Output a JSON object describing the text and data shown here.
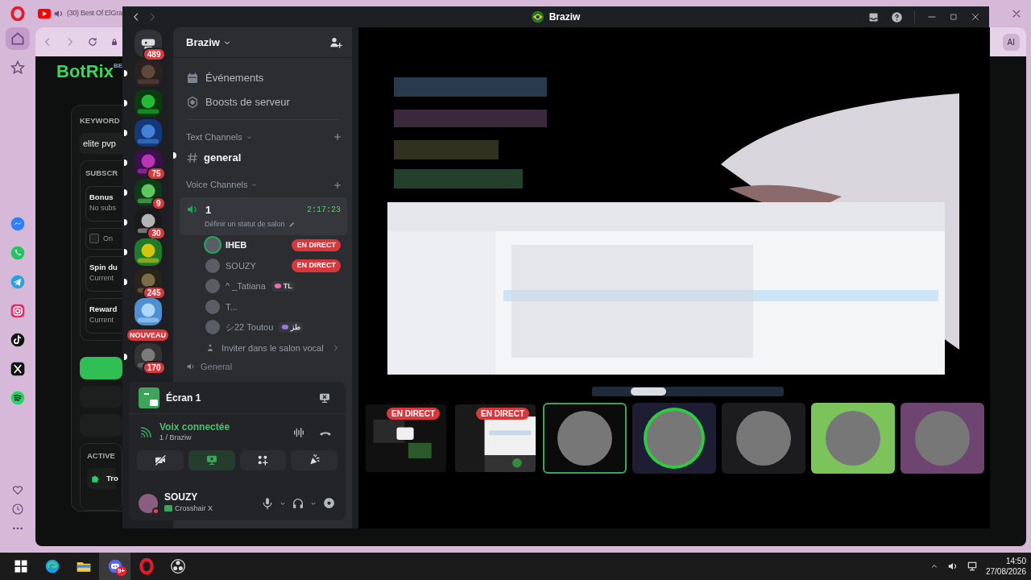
{
  "browser": {
    "tab_title": "(30) Best Of ElGra",
    "ai_button": "AI",
    "page": {
      "logo": "BotRix",
      "logo_badge": "BE",
      "keyword_label": "KEYWORD",
      "keyword_value": "elite pvp",
      "section_label": "SUBSCR",
      "rows": [
        {
          "kind": "card",
          "title": "Bonus",
          "subtitle": "No subs"
        },
        {
          "kind": "checkbox",
          "label": "On",
          "checked": false
        },
        {
          "kind": "card",
          "title": "Spin du",
          "subtitle": "Current"
        },
        {
          "kind": "card",
          "title": "Reward",
          "subtitle": "Current"
        }
      ],
      "action_label": "ACTIVE",
      "actions": [
        {
          "label": "Tro"
        }
      ]
    }
  },
  "sidebar": {
    "items": [
      {
        "kind": "home",
        "selected": true
      },
      {
        "kind": "star",
        "selected": false
      },
      {
        "kind": "messenger",
        "selected": false
      },
      {
        "kind": "whatsapp",
        "selected": false
      },
      {
        "kind": "telegram",
        "selected": false
      },
      {
        "kind": "instagram",
        "selected": false
      },
      {
        "kind": "tiktok",
        "selected": false
      },
      {
        "kind": "x",
        "selected": false
      },
      {
        "kind": "spotify",
        "selected": false
      }
    ]
  },
  "discord": {
    "title": "Braziw",
    "servers": [
      {
        "kind": "home",
        "badge": "489",
        "unread": false
      },
      {
        "kind": "picture",
        "unread": true
      },
      {
        "kind": "picture",
        "unread": true
      },
      {
        "kind": "picture",
        "unread": true
      },
      {
        "kind": "picture",
        "badge": "75",
        "unread": true
      },
      {
        "kind": "picture",
        "badge": "9",
        "unread": true
      },
      {
        "kind": "picture",
        "badge": "30",
        "unread": true
      },
      {
        "kind": "picture",
        "unread": true
      },
      {
        "kind": "picture",
        "badge": "245",
        "unread": true
      },
      {
        "kind": "picture",
        "unread": false
      },
      {
        "kind": "picture",
        "badge": "170",
        "label": "NOUVEAU",
        "unread": true
      }
    ],
    "server_name": "Braziw",
    "menu": [
      {
        "kind": "events",
        "label": "Événements"
      },
      {
        "kind": "boosts",
        "label": "Boosts de serveur"
      }
    ],
    "categories": [
      {
        "name": "Text Channels",
        "channels": [
          {
            "kind": "text",
            "name": "general",
            "unread": true,
            "selected": false
          }
        ]
      },
      {
        "name": "Voice Channels",
        "channels": [
          {
            "kind": "voice",
            "name": "1",
            "unread": false,
            "selected": true,
            "timer": "2:17:23",
            "status": "Définir un statut de salon",
            "invite": "Inviter dans le salon vocal",
            "members": [
              {
                "name": "IHEB",
                "speaking": true,
                "badge": "EN DIRECT"
              },
              {
                "name": "SOUZY",
                "speaking": false,
                "badge": "EN DIRECT"
              },
              {
                "name": "^ _Tatiana",
                "speaking": false,
                "tag": {
                  "kind": "lips",
                  "text": "TL"
                }
              },
              {
                "name": "T...",
                "speaking": false
              },
              {
                "name": "シ22 Toutou",
                "speaking": false,
                "tag": {
                  "kind": "frog",
                  "text": "طز"
                }
              }
            ]
          }
        ]
      }
    ],
    "next_channel": "General",
    "panel": {
      "screen": "Écran 1",
      "voice_status": "Voix connectée",
      "voice_channel": "1 / Braziw",
      "buttons": [
        {
          "kind": "camera",
          "active": false
        },
        {
          "kind": "screen",
          "active": true
        },
        {
          "kind": "activities",
          "active": false
        },
        {
          "kind": "soundboard",
          "active": false
        }
      ],
      "user": {
        "name": "SOUZY",
        "activity": "Crosshair X",
        "do_not_disturb": true
      }
    },
    "tiles": [
      {
        "kind": "stream",
        "badge": "EN DIRECT",
        "selected": false
      },
      {
        "kind": "stream",
        "badge": "EN DIRECT",
        "selected": false
      },
      {
        "kind": "avatar",
        "color": "#0b0b0c",
        "selected": true,
        "speaking": false
      },
      {
        "kind": "avatar",
        "color": "#1d1e33",
        "selected": false,
        "speaking": true
      },
      {
        "kind": "avatar",
        "color": "#1c1c1e",
        "selected": false,
        "speaking": false
      },
      {
        "kind": "avatar",
        "color": "#7dc35b",
        "selected": false,
        "speaking": false
      },
      {
        "kind": "avatar",
        "color": "#6e4470",
        "selected": false,
        "speaking": false
      }
    ]
  },
  "taskbar": {
    "apps": [
      {
        "kind": "start",
        "active": false
      },
      {
        "kind": "edge",
        "active": false
      },
      {
        "kind": "files",
        "active": false
      },
      {
        "kind": "discord",
        "active": true,
        "badge": "9+"
      },
      {
        "kind": "opera",
        "active": false
      },
      {
        "kind": "obs",
        "active": false
      }
    ],
    "time": "14:50",
    "date": "27/08/2026"
  }
}
